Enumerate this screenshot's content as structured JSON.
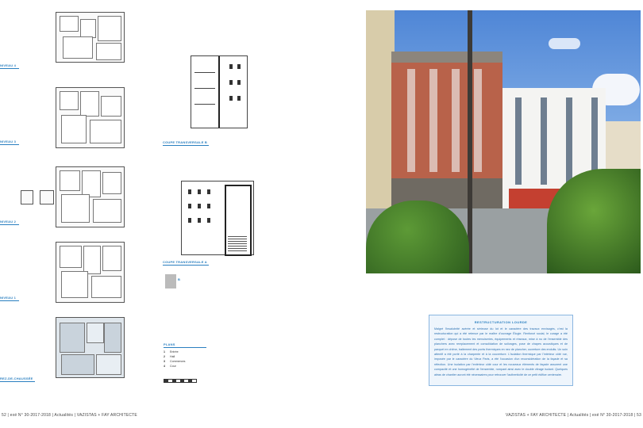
{
  "plans": {
    "level4": "NIVEAU 4",
    "level3": "NIVEAU 3",
    "level2": "NIVEAU 2",
    "level1": "NIVEAU 1",
    "ground": "REZ-DE-CHAUSSÉE"
  },
  "sections": {
    "section_b": "COUPE TRANSVERSALE B",
    "section_a": "COUPE TRANSVERSALE A",
    "mark": "B"
  },
  "legend": {
    "title": "PLANS",
    "items": [
      {
        "n": "1",
        "label": "Entrée"
      },
      {
        "n": "2",
        "label": "Hall"
      },
      {
        "n": "3",
        "label": "Commerces"
      },
      {
        "n": "4",
        "label": "Cour"
      }
    ]
  },
  "textbox": {
    "title": "RESTRUCTURATION LOURDE",
    "body": "Malgré l'insalubrité avérée et sérieuse du lot et le caractère des travaux envisagés, c'est la restructuration qui a été retenue par le maître d'ouvrage Élogie. Renforcé social, le curage a été complet : dépose de toutes les menuiseries, équipements et réseaux, mise à nu de l'ensemble des planchers avec remplacement et consolidation de solivages, pose de chapes acoustiques et de parquet en chêne, traitement des ponts thermiques en nez de plancher, ouverture des enduits. Un soin attentif a été porté à la charpente et à la couverture. L'isolation thermique par l'intérieur côté rue, imposée par le caractère du Vieux Paris, a été l'occasion d'un reconsidération de la façade et sa réfection. Une isolation par l'extérieur côté cour et les nouveaux éléments de façade assurent une compacité et une homogénéité de l'ensemble, rompant ainsi avec le double vitrage isolant. Quelques aléas de chantier auront été nécessaires pour retrouver l'authenticité de ce petit édifice centenaire."
  },
  "footer": {
    "left": "52 | exé N° 30-2017-2018 | Actualités | VAZISTAS + FAY ARCHITECTE",
    "right": "VAZISTAS + FAY ARCHITECTE | Actualités | exé N° 30-2017-2018 | 53"
  }
}
